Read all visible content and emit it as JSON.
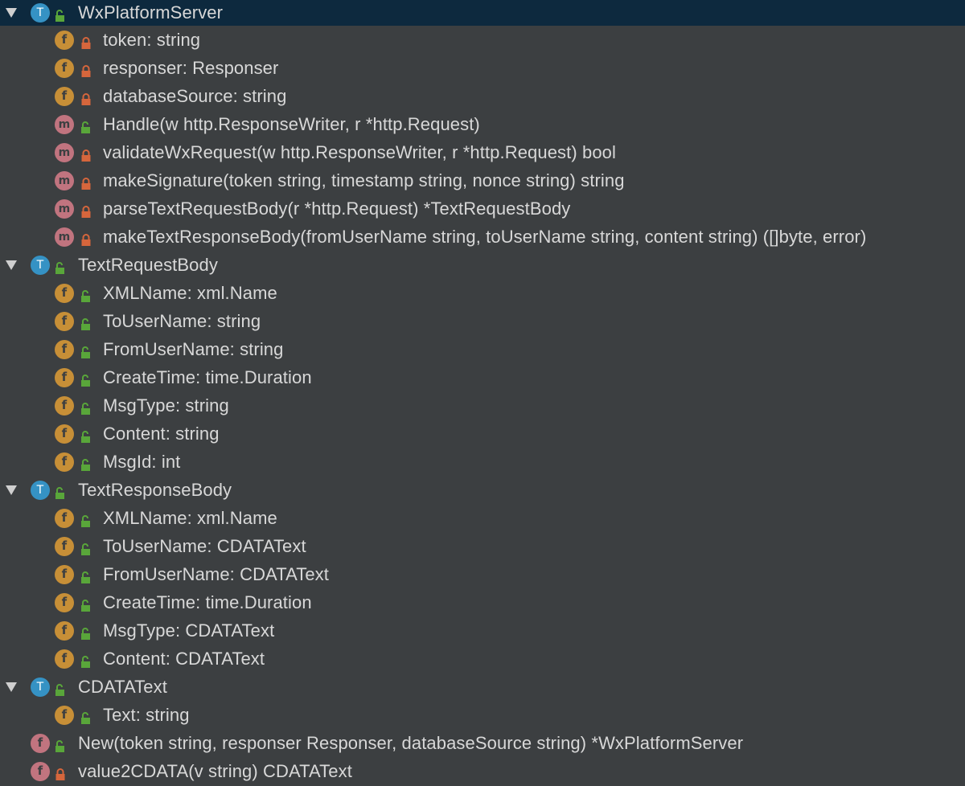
{
  "colors": {
    "background": "#3c3f41",
    "selected_row": "#0d293e",
    "type_badge": "#3592c4",
    "field_badge": "#c78f37",
    "method_badge": "#c1747f",
    "public_lock": "#59a63a",
    "private_lock": "#d6663c",
    "text": "#d8d8d8"
  },
  "tree": [
    {
      "level": 0,
      "expanded": true,
      "kind": "T",
      "kind_icon": "type-icon",
      "access": "public",
      "label": "WxPlatformServer",
      "selected": true
    },
    {
      "level": 1,
      "kind": "f",
      "kind_icon": "field-icon",
      "access": "private",
      "label": "token: string"
    },
    {
      "level": 1,
      "kind": "f",
      "kind_icon": "field-icon",
      "access": "private",
      "label": "responser: Responser"
    },
    {
      "level": 1,
      "kind": "f",
      "kind_icon": "field-icon",
      "access": "private",
      "label": "databaseSource: string"
    },
    {
      "level": 1,
      "kind": "m",
      "kind_icon": "method-icon",
      "access": "public",
      "label": "Handle(w http.ResponseWriter, r *http.Request)"
    },
    {
      "level": 1,
      "kind": "m",
      "kind_icon": "method-icon",
      "access": "private",
      "label": "validateWxRequest(w http.ResponseWriter, r *http.Request) bool"
    },
    {
      "level": 1,
      "kind": "m",
      "kind_icon": "method-icon",
      "access": "private",
      "label": "makeSignature(token string, timestamp string, nonce string) string"
    },
    {
      "level": 1,
      "kind": "m",
      "kind_icon": "method-icon",
      "access": "private",
      "label": "parseTextRequestBody(r *http.Request) *TextRequestBody"
    },
    {
      "level": 1,
      "kind": "m",
      "kind_icon": "method-icon",
      "access": "private",
      "label": "makeTextResponseBody(fromUserName string, toUserName string, content string) ([]byte, error)"
    },
    {
      "level": 0,
      "expanded": true,
      "kind": "T",
      "kind_icon": "type-icon",
      "access": "public",
      "label": "TextRequestBody"
    },
    {
      "level": 1,
      "kind": "f",
      "kind_icon": "field-icon",
      "access": "public",
      "label": "XMLName: xml.Name"
    },
    {
      "level": 1,
      "kind": "f",
      "kind_icon": "field-icon",
      "access": "public",
      "label": "ToUserName: string"
    },
    {
      "level": 1,
      "kind": "f",
      "kind_icon": "field-icon",
      "access": "public",
      "label": "FromUserName: string"
    },
    {
      "level": 1,
      "kind": "f",
      "kind_icon": "field-icon",
      "access": "public",
      "label": "CreateTime: time.Duration"
    },
    {
      "level": 1,
      "kind": "f",
      "kind_icon": "field-icon",
      "access": "public",
      "label": "MsgType: string"
    },
    {
      "level": 1,
      "kind": "f",
      "kind_icon": "field-icon",
      "access": "public",
      "label": "Content: string"
    },
    {
      "level": 1,
      "kind": "f",
      "kind_icon": "field-icon",
      "access": "public",
      "label": "MsgId: int"
    },
    {
      "level": 0,
      "expanded": true,
      "kind": "T",
      "kind_icon": "type-icon",
      "access": "public",
      "label": "TextResponseBody"
    },
    {
      "level": 1,
      "kind": "f",
      "kind_icon": "field-icon",
      "access": "public",
      "label": "XMLName: xml.Name"
    },
    {
      "level": 1,
      "kind": "f",
      "kind_icon": "field-icon",
      "access": "public",
      "label": "ToUserName: CDATAText"
    },
    {
      "level": 1,
      "kind": "f",
      "kind_icon": "field-icon",
      "access": "public",
      "label": "FromUserName: CDATAText"
    },
    {
      "level": 1,
      "kind": "f",
      "kind_icon": "field-icon",
      "access": "public",
      "label": "CreateTime: time.Duration"
    },
    {
      "level": 1,
      "kind": "f",
      "kind_icon": "field-icon",
      "access": "public",
      "label": "MsgType: CDATAText"
    },
    {
      "level": 1,
      "kind": "f",
      "kind_icon": "field-icon",
      "access": "public",
      "label": "Content: CDATAText"
    },
    {
      "level": 0,
      "expanded": true,
      "kind": "T",
      "kind_icon": "type-icon",
      "access": "public",
      "label": "CDATAText"
    },
    {
      "level": 1,
      "kind": "f",
      "kind_icon": "field-icon",
      "access": "public",
      "label": "Text: string"
    },
    {
      "level": 0,
      "kind": "f",
      "kind_icon": "function-icon",
      "access": "public",
      "label": "New(token string, responser Responser, databaseSource string) *WxPlatformServer"
    },
    {
      "level": 0,
      "kind": "f",
      "kind_icon": "function-icon",
      "access": "private",
      "label": "value2CDATA(v string) CDATAText"
    }
  ]
}
